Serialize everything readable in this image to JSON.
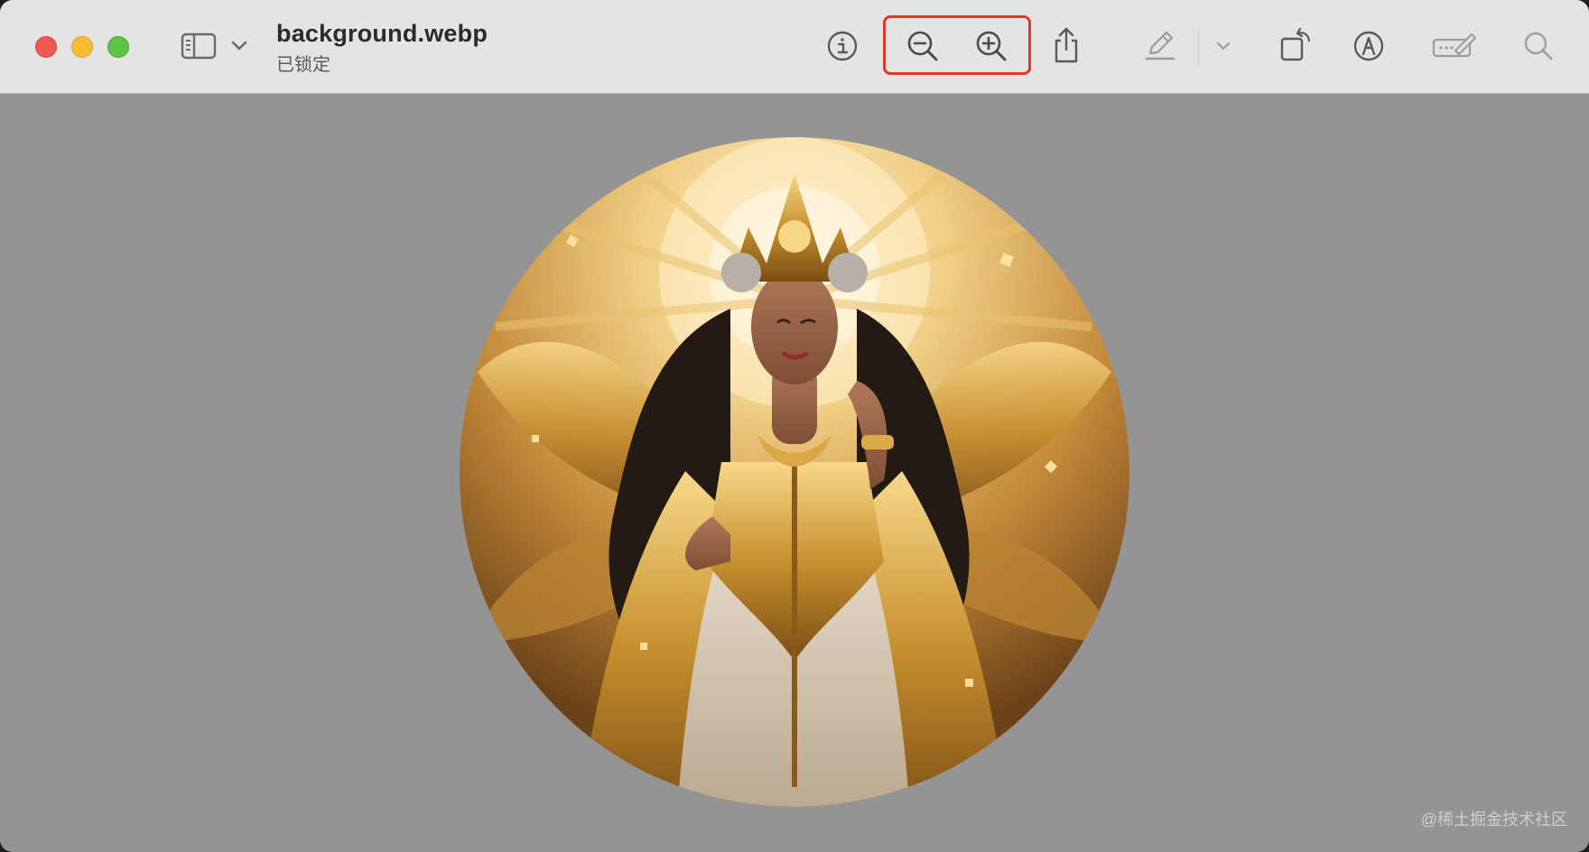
{
  "window": {
    "title": "background.webp",
    "subtitle": "已锁定"
  },
  "toolbar": {
    "icons": [
      "sidebar-icon",
      "chevron-down-icon",
      "info-icon",
      "zoom-out-icon",
      "zoom-in-icon",
      "share-icon",
      "highlight-pen-icon",
      "chevron-down-icon",
      "rotate-icon",
      "markup-icon",
      "signature-icon",
      "search-icon"
    ],
    "highlight_color": "#e0392b"
  },
  "canvas": {
    "background_color": "#949494",
    "image_shape": "circle",
    "image_subject": "golden goddess portrait"
  },
  "watermark": "@稀土掘金技术社区"
}
